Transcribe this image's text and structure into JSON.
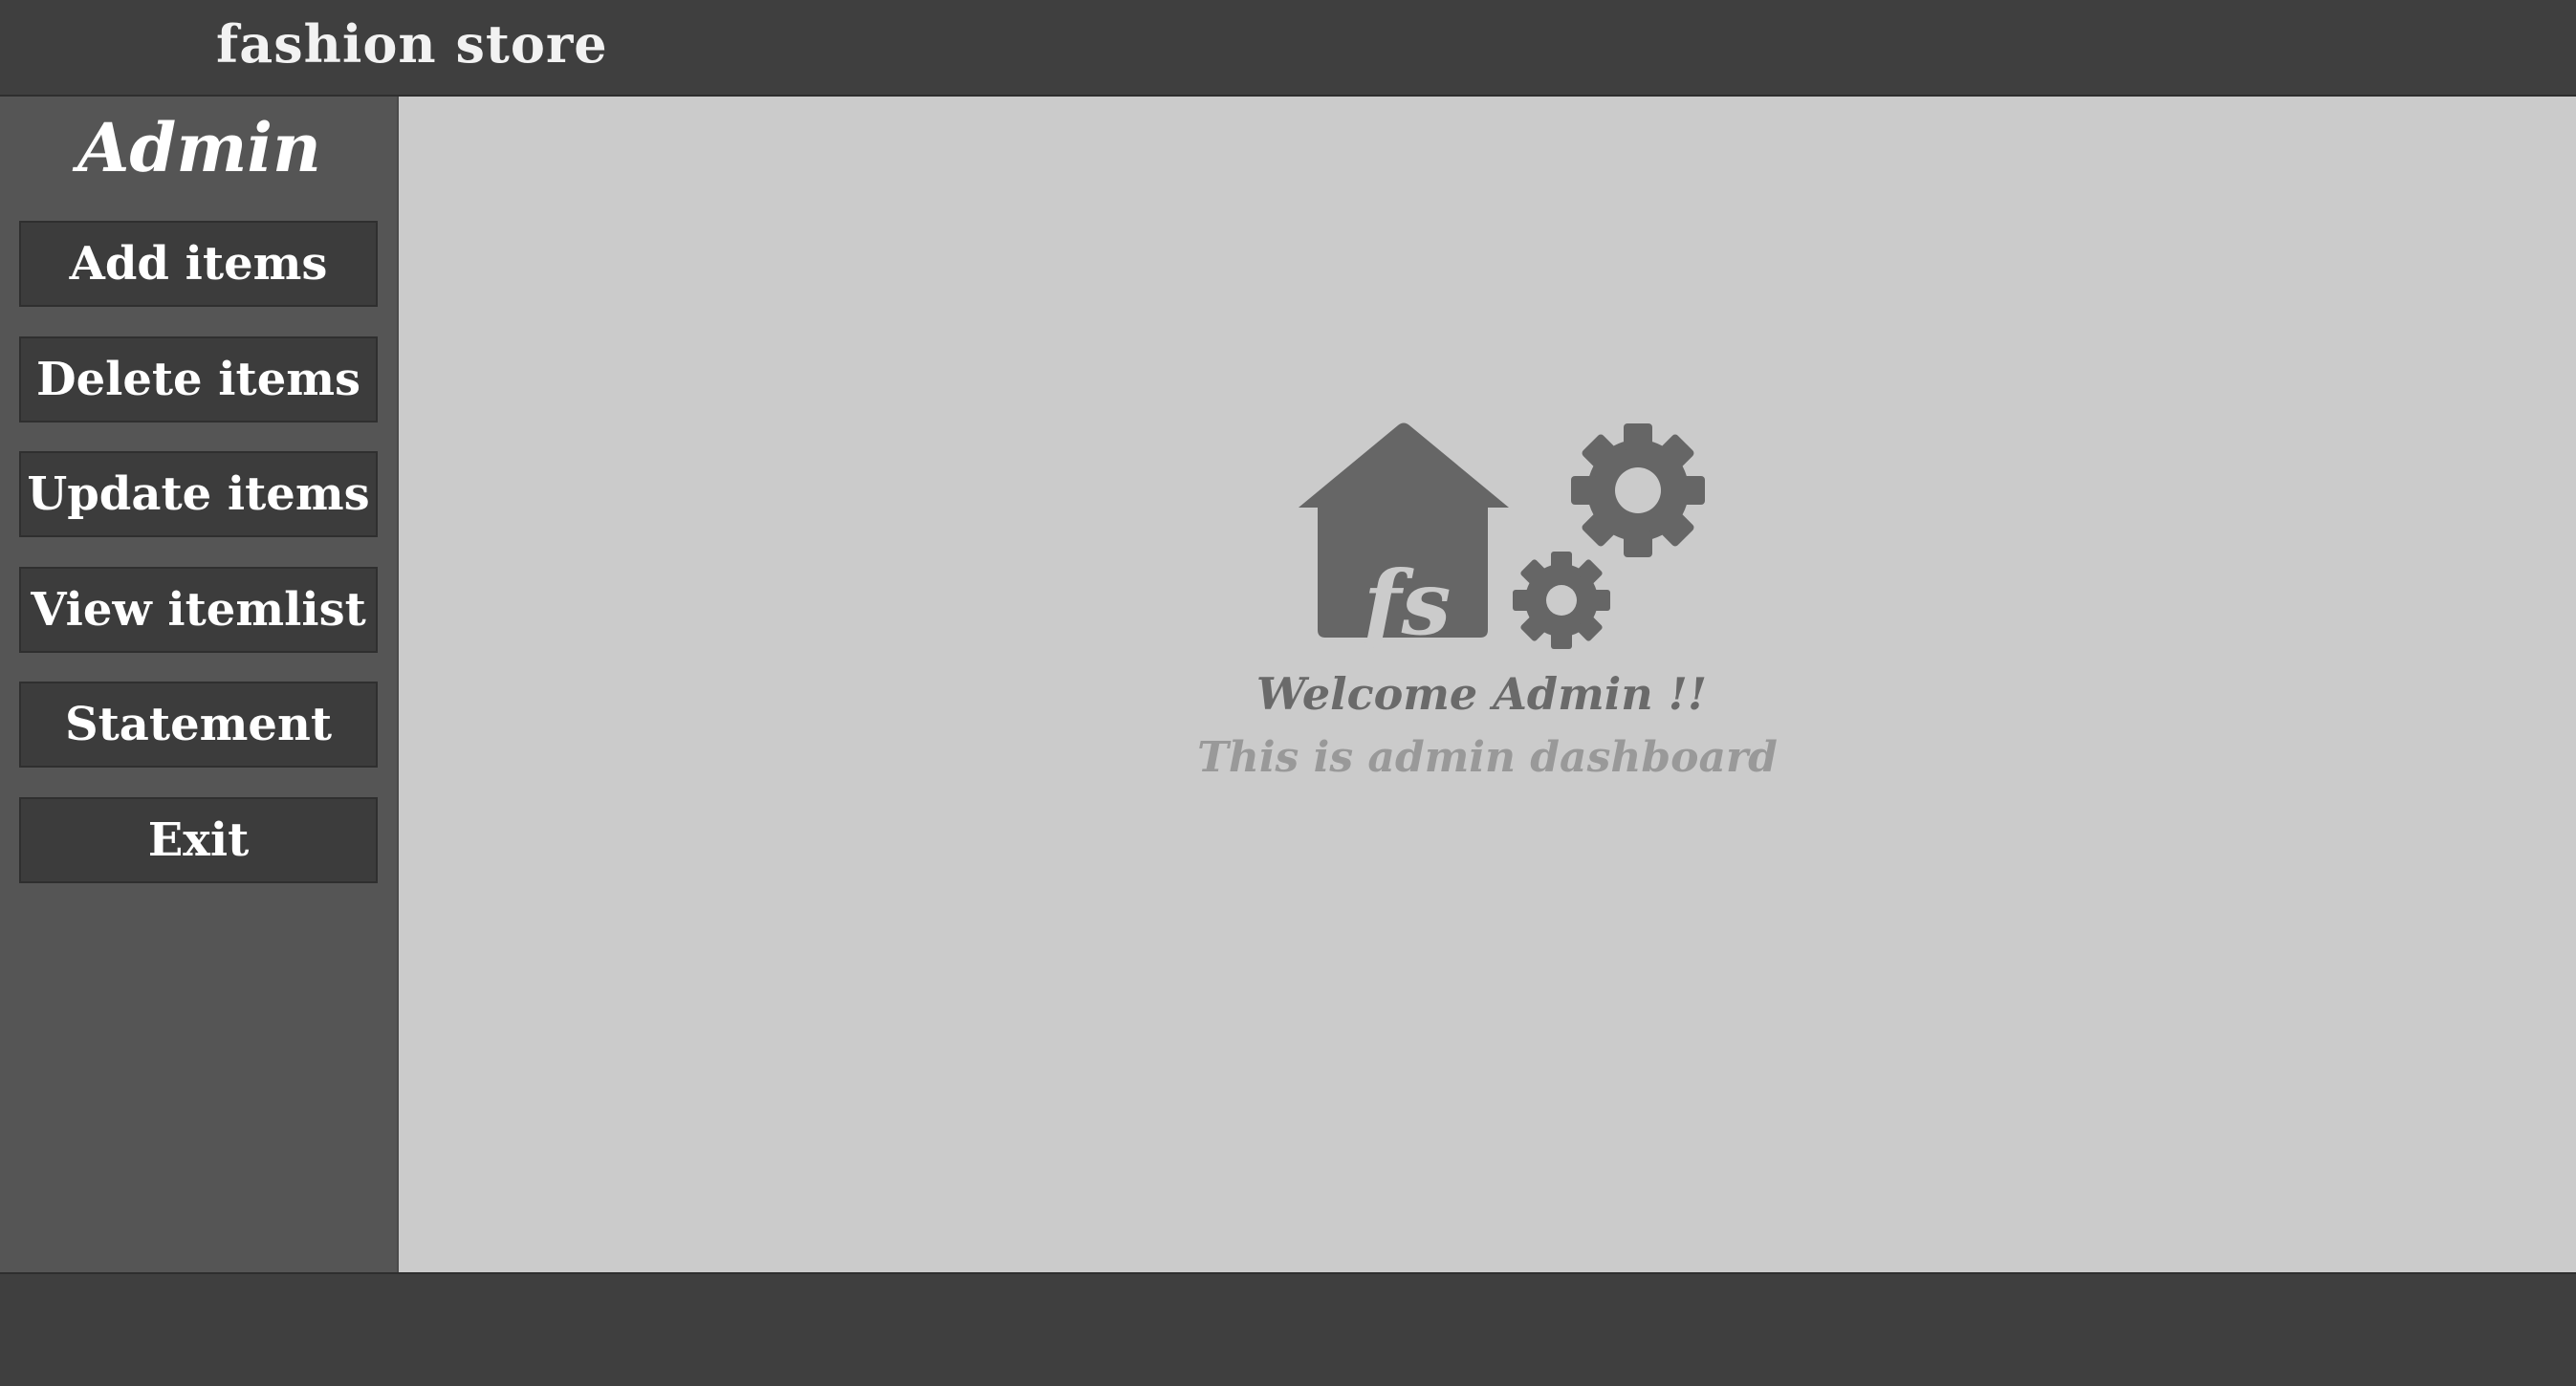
{
  "header": {
    "title": "fashion store"
  },
  "sidebar": {
    "heading": "Admin",
    "items": [
      {
        "label": "Add items"
      },
      {
        "label": "Delete items"
      },
      {
        "label": "Update items"
      },
      {
        "label": "View itemlist"
      },
      {
        "label": "Statement"
      },
      {
        "label": "Exit"
      }
    ]
  },
  "main": {
    "logo_text": "fs",
    "welcome": "Welcome Admin !!",
    "subtitle": "This is admin dashboard"
  },
  "colors": {
    "topbar": "#3f3f3f",
    "sidebar": "#555555",
    "button": "#3c3c3c",
    "main_bg": "#cbcbcb",
    "logo": "#666666",
    "welcome_text": "#6a6a6a",
    "subtitle_text": "#999999"
  }
}
